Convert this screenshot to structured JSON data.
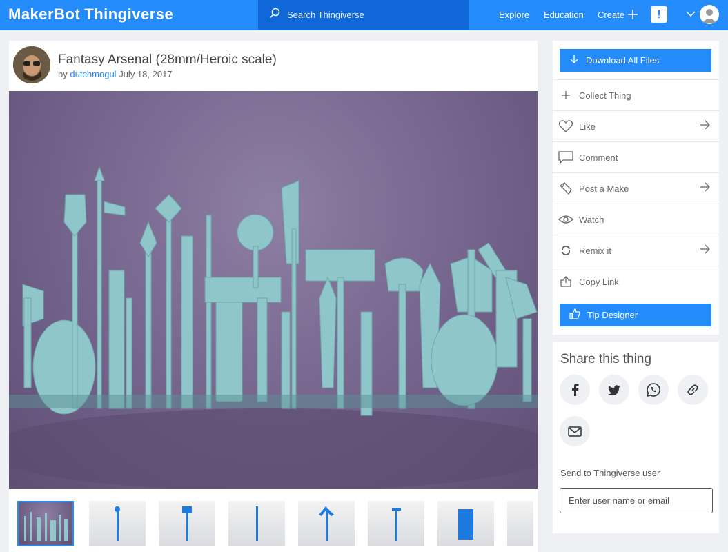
{
  "header": {
    "logo_brand": "MakerBot",
    "logo_product": "Thingiverse",
    "search_placeholder": "Search Thingiverse",
    "nav": [
      "Explore",
      "Education",
      "Create"
    ],
    "alert_glyph": "!",
    "brand_color": "#248bfb"
  },
  "thing": {
    "title": "Fantasy Arsenal (28mm/Heroic scale)",
    "by": "by",
    "author": "dutchmogul",
    "date": "July 18, 2017"
  },
  "actions": {
    "download": "Download All Files",
    "items": [
      {
        "label": "Collect Thing",
        "icon": "plus-icon"
      },
      {
        "label": "Like",
        "icon": "heart-icon"
      },
      {
        "label": "Comment",
        "icon": "comment-icon"
      },
      {
        "label": "Post a Make",
        "icon": "pencil-icon"
      },
      {
        "label": "Watch",
        "icon": "eye-icon"
      },
      {
        "label": "Remix it",
        "icon": "remix-icon"
      },
      {
        "label": "Copy Link",
        "icon": "share-icon"
      }
    ],
    "tip": "Tip Designer"
  },
  "share": {
    "title": "Share this thing",
    "networks": [
      "facebook-icon",
      "twitter-icon",
      "whatsapp-icon",
      "link-icon",
      "email-icon"
    ],
    "send_label": "Send to Thingiverse user",
    "send_placeholder": "Enter user name or email"
  }
}
